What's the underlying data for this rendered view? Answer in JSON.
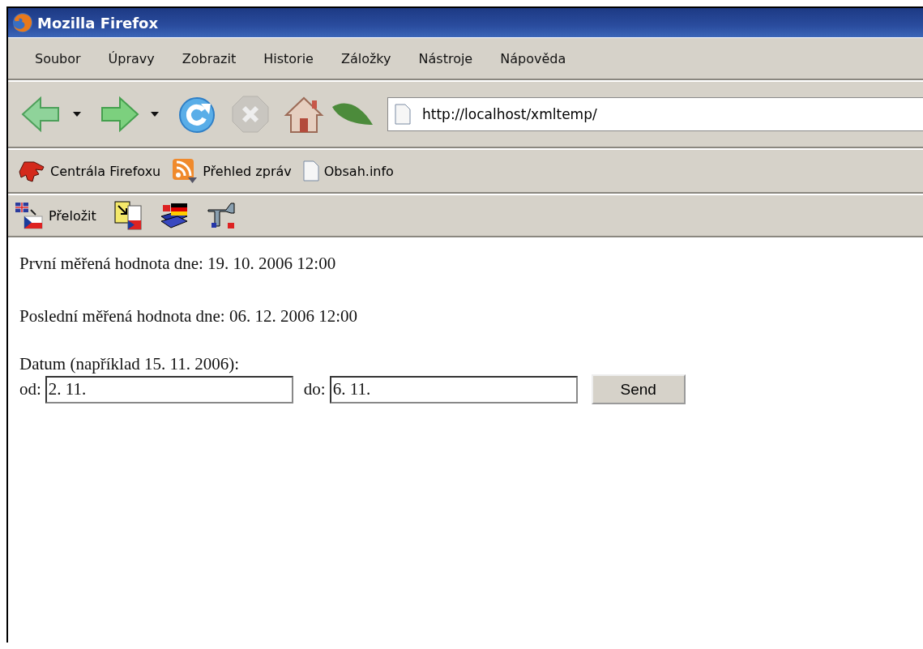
{
  "window": {
    "title": "Mozilla Firefox"
  },
  "menu": [
    {
      "label": "Soubor"
    },
    {
      "label": "Úpravy"
    },
    {
      "label": "Zobrazit"
    },
    {
      "label": "Historie"
    },
    {
      "label": "Záložky"
    },
    {
      "label": "Nástroje"
    },
    {
      "label": "Nápověda"
    }
  ],
  "navigation": {
    "back_enabled": true,
    "forward_enabled": true,
    "stop_enabled": false,
    "address": "http://localhost/xmltemp/"
  },
  "bookmarks": [
    {
      "kind": "dino",
      "label": "Centrála Firefoxu"
    },
    {
      "kind": "feed",
      "label": "Přehled zpráv"
    },
    {
      "kind": "page",
      "label": "Obsah.info"
    }
  ],
  "addon_toolbar": [
    {
      "kind": "translate",
      "label": "Přeložit"
    },
    {
      "kind": "doc"
    },
    {
      "kind": "books"
    },
    {
      "kind": "tool"
    }
  ],
  "page": {
    "paragraphs": [
      "První měřená hodnota dne: 19. 10. 2006 12:00",
      "Poslední měřená hodnota dne: 06. 12. 2006 12:00"
    ],
    "form_label": "Datum (například 15. 11. 2006):",
    "fields": [
      {
        "label": "od:",
        "value": "2. 11."
      },
      {
        "label": "do:",
        "value": "6. 11."
      }
    ],
    "submit": "Send"
  }
}
